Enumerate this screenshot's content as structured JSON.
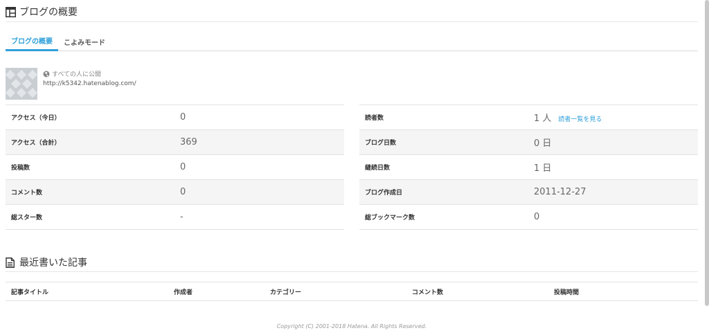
{
  "overview": {
    "title": "ブログの概要",
    "tabs": [
      {
        "label": "ブログの概要",
        "active": true
      },
      {
        "label": "こよみモード",
        "active": false
      }
    ],
    "visibility": "すべての人に公開",
    "url": "http://k5342.hatenablog.com/"
  },
  "stats": {
    "left": [
      {
        "label": "アクセス（今日）",
        "value": "0"
      },
      {
        "label": "アクセス（合計）",
        "value": "369"
      },
      {
        "label": "投稿数",
        "value": "0"
      },
      {
        "label": "コメント数",
        "value": "0"
      },
      {
        "label": "総スター数",
        "value": "-"
      }
    ],
    "right": [
      {
        "label": "読者数",
        "value": "1 人",
        "link": "読者一覧を見る"
      },
      {
        "label": "ブログ日数",
        "value": "0 日"
      },
      {
        "label": "継続日数",
        "value": "1 日"
      },
      {
        "label": "ブログ作成日",
        "value": "2011-12-27"
      },
      {
        "label": "総ブックマーク数",
        "value": "0"
      }
    ]
  },
  "recent": {
    "title": "最近書いた記事",
    "columns": [
      "記事タイトル",
      "作成者",
      "カテゴリー",
      "コメント数",
      "投稿時間"
    ]
  },
  "footer": {
    "copyright": "Copyright (C) 2001-2018 Hatena. All Rights Reserved."
  },
  "colors": {
    "accent": "#2d9fd9"
  },
  "icons": {
    "overview": "dashboard-icon",
    "visibility": "globe-icon",
    "recent": "document-icon"
  }
}
